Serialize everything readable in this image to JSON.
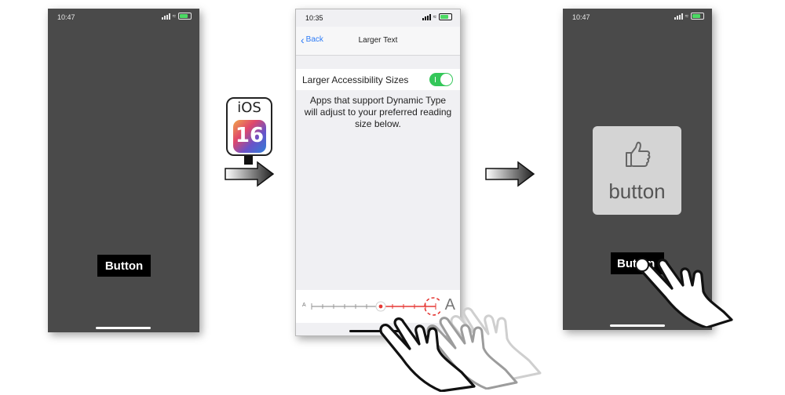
{
  "left_phone": {
    "time": "10:47",
    "button_label": "Button"
  },
  "ios_badge": {
    "label": "iOS",
    "version": "16"
  },
  "settings_phone": {
    "time": "10:35",
    "back_label": "Back",
    "title": "Larger Text",
    "toggle_label": "Larger Accessibility Sizes",
    "toggle_on": true,
    "description": "Apps that support Dynamic Type will adjust to your preferred reading size below.",
    "slider_small_label": "A",
    "slider_large_label": "A",
    "slider_level": 0.6
  },
  "right_phone": {
    "time": "10:47",
    "card_label": "button",
    "card_icon": "thumbs-up-icon",
    "button_label": "Button"
  },
  "colors": {
    "accent": "#2f7cf6",
    "toggle_on": "#34c759",
    "slider_active": "#e53935",
    "phone_dark": "#4a4a4a"
  }
}
